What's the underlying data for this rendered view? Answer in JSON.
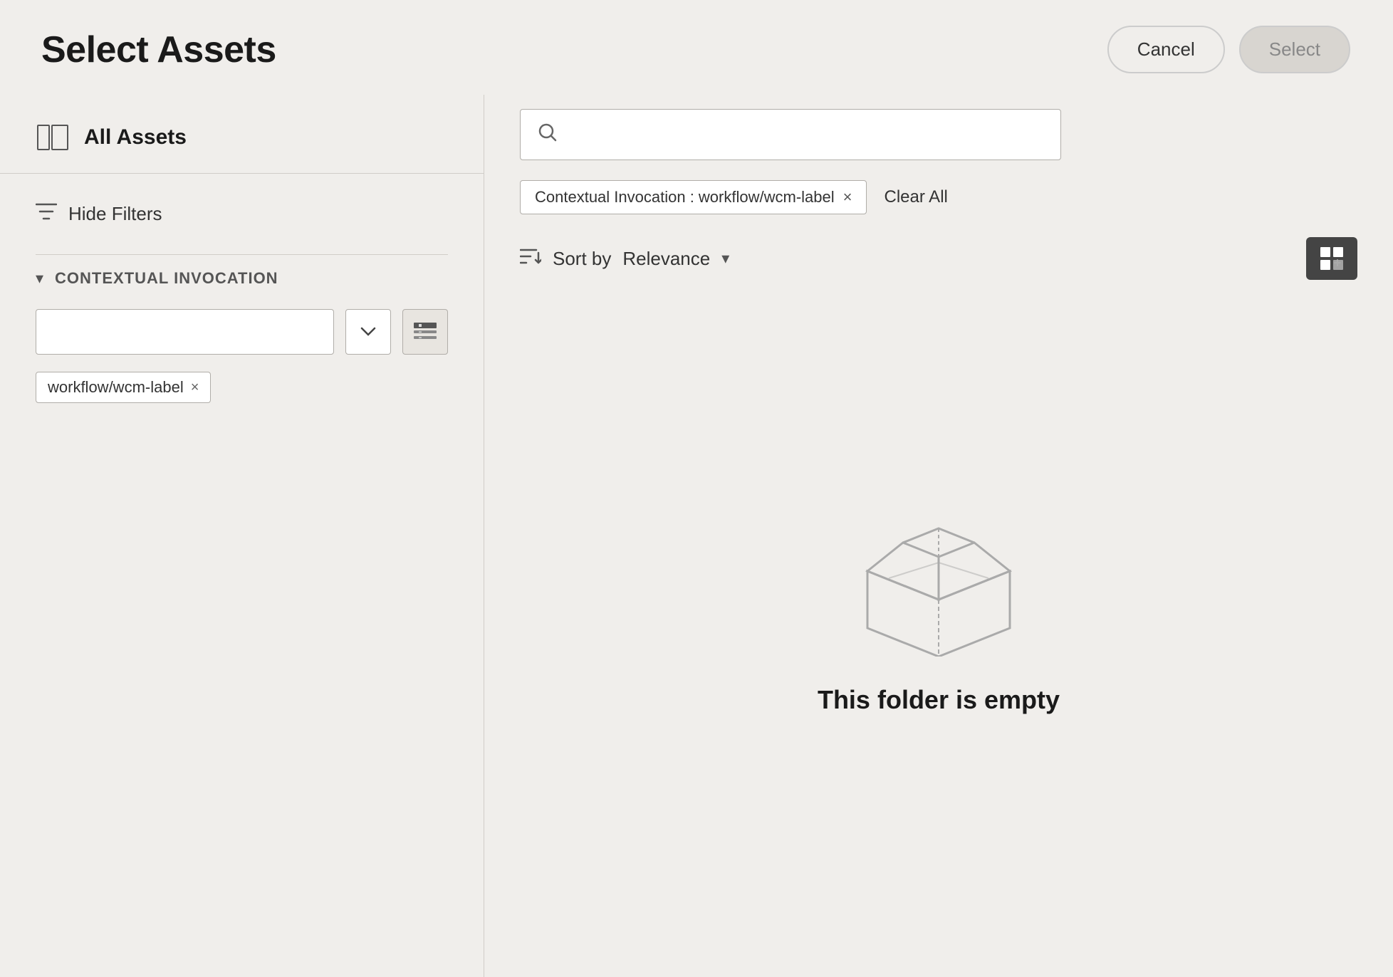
{
  "page": {
    "title": "Select Assets"
  },
  "header": {
    "cancel_label": "Cancel",
    "select_label": "Select"
  },
  "sidebar": {
    "all_assets_label": "All Assets",
    "hide_filters_label": "Hide Filters",
    "contextual_invocation": {
      "section_title": "CONTEXTUAL INVOCATION",
      "dropdown_placeholder": "",
      "tag_value": "workflow/wcm-label",
      "tag_close": "×"
    }
  },
  "content": {
    "search_placeholder": "",
    "filter_tag_label": "Contextual Invocation : workflow/wcm-label",
    "filter_tag_close": "×",
    "clear_all_label": "Clear All",
    "sort_by_label": "Sort by",
    "sort_value": "Relevance",
    "empty_message": "This folder is empty"
  }
}
